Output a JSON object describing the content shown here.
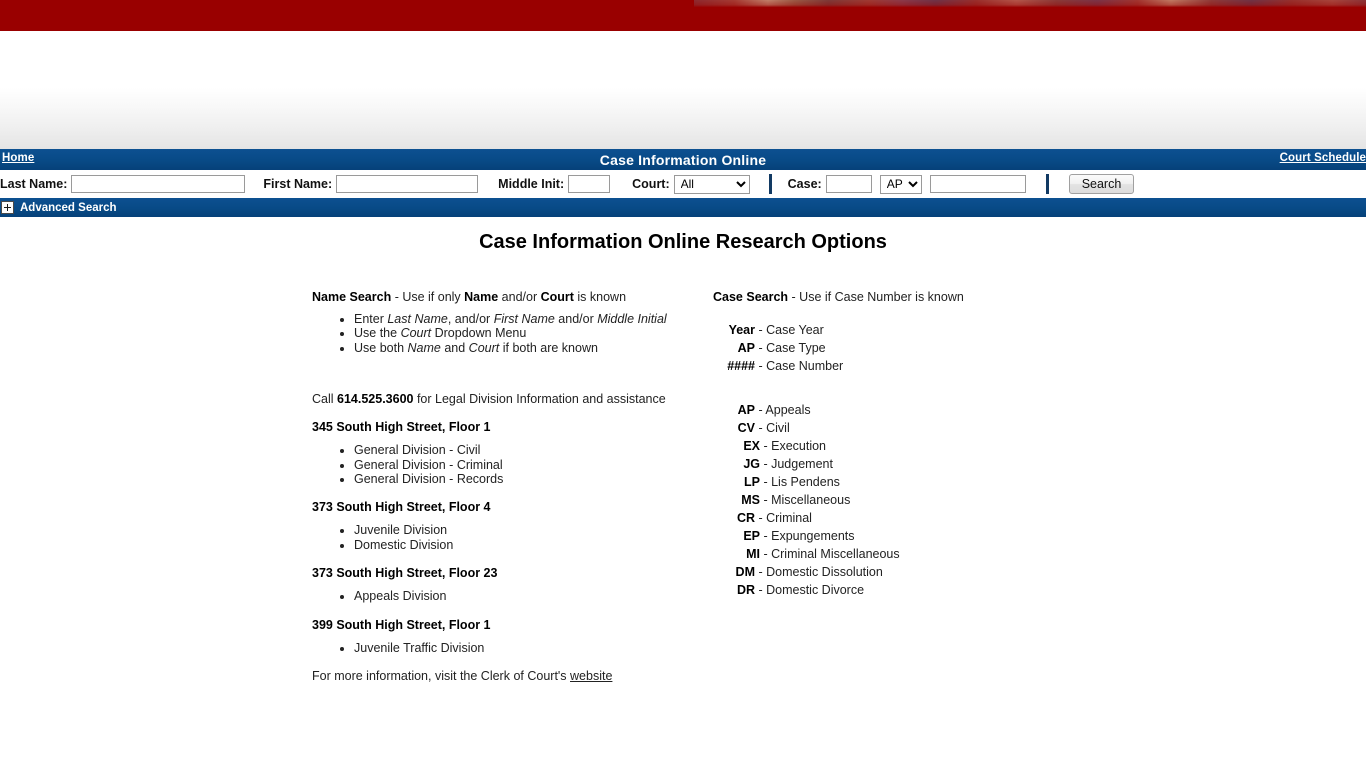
{
  "banner": {
    "background_color": "#990000"
  },
  "nav": {
    "home_label": "Home",
    "title": "Case Information Online",
    "court_schedule_label": "Court Schedule",
    "background_color": "#084a86"
  },
  "search_form": {
    "last_name_label": "Last Name:",
    "last_name_value": "",
    "first_name_label": "First Name:",
    "first_name_value": "",
    "middle_init_label": "Middle Init:",
    "middle_init_value": "",
    "court_label": "Court:",
    "court_value": "All",
    "court_options": [
      "All"
    ],
    "case_label": "Case:",
    "case_year_value": "",
    "case_type_value": "AP",
    "case_type_options": [
      "AP"
    ],
    "case_number_value": "",
    "search_button_label": "Search"
  },
  "advanced_search": {
    "label": "Advanced Search",
    "expand_icon": "plus-icon"
  },
  "page_title": "Case Information Online Research Options",
  "name_search": {
    "heading_bold": "Name Search",
    "heading_rest_1": " - Use if only ",
    "heading_bold_2": "Name",
    "heading_rest_2": " and/or ",
    "heading_bold_3": "Court",
    "heading_rest_3": " is known",
    "bullets": [
      {
        "pre": "Enter ",
        "i1": "Last Name",
        "mid1": ", and/or ",
        "i2": "First Name",
        "mid2": " and/or ",
        "i3": "Middle Initial",
        "post": ""
      },
      {
        "pre": "Use the ",
        "i1": "Court",
        "mid1": " Dropdown Menu",
        "i2": "",
        "mid2": "",
        "i3": "",
        "post": ""
      },
      {
        "pre": "Use both ",
        "i1": "Name",
        "mid1": " and ",
        "i2": "Court",
        "mid2": " if both are known",
        "i3": "",
        "post": ""
      }
    ],
    "phone_pre": "Call ",
    "phone_number": "614.525.3600",
    "phone_post": " for Legal Division Information and assistance",
    "locations": [
      {
        "address": "345 South High Street, Floor 1",
        "divisions": [
          "General Division - Civil",
          "General Division - Criminal",
          "General Division - Records"
        ]
      },
      {
        "address": "373 South High Street, Floor 4",
        "divisions": [
          "Juvenile Division",
          "Domestic Division"
        ]
      },
      {
        "address": "373 South High Street, Floor 23",
        "divisions": [
          "Appeals Division"
        ]
      },
      {
        "address": "399 South High Street, Floor 1",
        "divisions": [
          "Juvenile Traffic Division"
        ]
      }
    ],
    "footer_pre": "For more information, visit the Clerk of Court's ",
    "footer_link": "website"
  },
  "case_search": {
    "heading_bold": "Case Search",
    "heading_rest": " - Use if Case Number is known",
    "format_rows": [
      {
        "code": "Year",
        "desc": "Case Year"
      },
      {
        "code": "AP",
        "desc": "Case Type"
      },
      {
        "code": "####",
        "desc": "Case Number"
      }
    ],
    "code_rows": [
      {
        "code": "AP",
        "desc": "Appeals",
        "level": 0
      },
      {
        "code": "CV",
        "desc": "Civil",
        "level": 0
      },
      {
        "code": "EX",
        "desc": "Execution",
        "level": 1
      },
      {
        "code": "JG",
        "desc": "Judgement",
        "level": 1
      },
      {
        "code": "LP",
        "desc": "Lis Pendens",
        "level": 1
      },
      {
        "code": "MS",
        "desc": "Miscellaneous",
        "level": 1
      },
      {
        "code": "CR",
        "desc": "Criminal",
        "level": 0
      },
      {
        "code": "EP",
        "desc": "Expungements",
        "level": 1
      },
      {
        "code": "MI",
        "desc": "Criminal Miscellaneous",
        "level": 1
      },
      {
        "code": "DM",
        "desc": "Domestic Dissolution",
        "level": 0
      },
      {
        "code": "DR",
        "desc": "Domestic Divorce",
        "level": 0
      }
    ]
  }
}
